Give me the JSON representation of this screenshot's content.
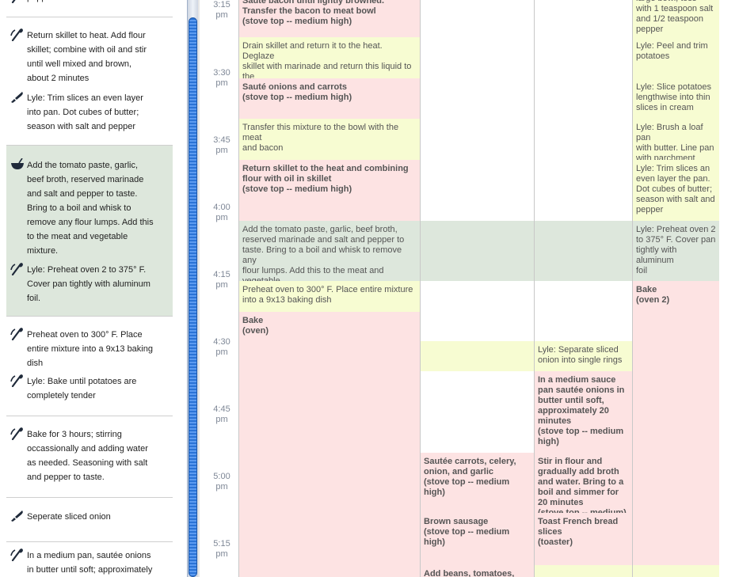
{
  "instructions": [
    {
      "items": [
        {
          "icon": "wooden-spoon-icon",
          "lines": [
            "pepper"
          ]
        }
      ]
    },
    {
      "items": [
        {
          "icon": "wooden-spoon-icon",
          "lines": [
            "Return skillet to heat. Add flour",
            "skillet; combine with oil and stir",
            "until well mixed and brown,",
            "about 2 minutes"
          ]
        },
        {
          "icon": "knife-icon",
          "lines": [
            "Lyle: Trim slices an even layer",
            "into pan. Dot cubes of butter;",
            "season with salt and pepper"
          ]
        }
      ]
    },
    {
      "active": true,
      "items": [
        {
          "icon": "mixing-bowl-icon",
          "lines": [
            "Add the tomato paste, garlic,",
            "beef broth, reserved marinade",
            "and salt and pepper to taste.",
            "Bring to a boil and whisk to",
            "remove any flour lumps. Add this",
            "to the meat and vegetable",
            "mixture."
          ]
        },
        {
          "icon": "wooden-spoon-icon",
          "lines": [
            "Lyle: Preheat oven 2 to 375° F.",
            "Cover pan tightly with aluminum",
            "foil."
          ]
        }
      ]
    },
    {
      "items": [
        {
          "icon": "wooden-spoon-icon",
          "lines": [
            "Preheat oven to 300° F. Place",
            "entire mixture into a 9x13 baking",
            "dish"
          ]
        },
        {
          "icon": "wooden-spoon-icon",
          "lines": [
            "Lyle: Bake until potatoes are",
            "completely tender"
          ]
        }
      ]
    },
    {
      "items": [
        {
          "icon": "wooden-spoon-icon",
          "lines": [
            "Bake for 3 hours; stirring",
            "occassionally and adding water",
            "as needed. Seasoning with salt",
            "and pepper to taste."
          ]
        }
      ]
    },
    {
      "items": [
        {
          "icon": "knife-icon",
          "lines": [
            "Seperate sliced onion"
          ]
        }
      ]
    },
    {
      "items": [
        {
          "icon": "wooden-spoon-icon",
          "lines": [
            "In a medium pan, sautée onions",
            "in butter until soft; approximately"
          ]
        }
      ]
    }
  ],
  "times": [
    [
      "3:15",
      "pm"
    ],
    [
      "3:30",
      "pm"
    ],
    [
      "3:45",
      "pm"
    ],
    [
      "4:00",
      "pm"
    ],
    [
      "4:15",
      "pm"
    ],
    [
      "4:30",
      "pm"
    ],
    [
      "4:45",
      "pm"
    ],
    [
      "5:00",
      "pm"
    ],
    [
      "5:15",
      "pm"
    ]
  ],
  "schedule": {
    "col1": [
      {
        "color": "pink",
        "bold": true,
        "lines": [
          "Sauté bacon until lightly browned.",
          "Transfer the bacon to meat bowl",
          "(stove top -- medium high)"
        ]
      },
      {
        "color": "yellow",
        "bold": false,
        "lines": [
          "Drain skillet and return it to the heat. Deglaze",
          "skillet with marinade and return this liquid to the",
          "reserved marinade"
        ]
      },
      {
        "color": "pink",
        "bold": true,
        "lines": [
          "Sauté onions and carrots",
          "(stove top -- medium high)"
        ]
      },
      {
        "color": "yellow",
        "bold": false,
        "lines": [
          "Transfer this mixture to the bowl with the meat",
          "and bacon"
        ]
      },
      {
        "color": "pink",
        "bold": true,
        "lines": [
          "Return skillet to the heat and combining",
          "flour with oil in skillet",
          "(stove top -- medium high)"
        ]
      },
      {
        "color": "green",
        "bold": false,
        "lines": [
          "Add the tomato paste, garlic, beef broth,",
          "reserved marinade and salt and pepper to",
          "taste. Bring to a boil and whisk to remove any",
          "flour lumps. Add this to the meat and vegetable",
          "mixture."
        ]
      },
      {
        "color": "yellow",
        "bold": false,
        "lines": [
          "Preheat oven to 300° F. Place entire mixture",
          "into a 9x13 baking dish"
        ]
      },
      {
        "color": "pink",
        "bold": true,
        "lines": [
          "Bake",
          "(oven)"
        ]
      }
    ],
    "col2": [
      {
        "color": "green",
        "bold": false,
        "lines": []
      },
      {
        "color": "yellow",
        "bold": false,
        "lines": []
      },
      {
        "color": "pink",
        "bold": true,
        "lines": [
          "Sautée carrots, celery,",
          "onion, and garlic",
          "(stove top -- medium",
          "high)"
        ]
      },
      {
        "color": "pink",
        "bold": true,
        "lines": [
          "Brown sausage",
          "(stove top -- medium",
          "high)"
        ]
      },
      {
        "color": "pink",
        "bold": true,
        "lines": [
          "Add beans, tomatoes,"
        ]
      }
    ],
    "col3": [
      {
        "color": "green",
        "bold": false,
        "lines": []
      },
      {
        "color": "yellow",
        "bold": false,
        "lines": [
          "Lyle: Separate sliced",
          "onion into single rings"
        ]
      },
      {
        "color": "pink",
        "bold": true,
        "lines": [
          "In a medium sauce",
          "pan sautée onions in",
          "butter until soft,",
          "approximately 20",
          "minutes",
          "(stove top -- medium",
          "high)"
        ]
      },
      {
        "color": "pink",
        "bold": true,
        "lines": [
          "Stir in flour and",
          "gradually add broth",
          "and water. Bring to a",
          "boil and simmer for",
          "20 minutes",
          "(stove top -- medium)"
        ]
      },
      {
        "color": "pink",
        "bold": true,
        "lines": [
          "Toast French bread",
          "slices",
          "(toaster)"
        ]
      },
      {
        "color": "yellow",
        "bold": false,
        "lines": []
      }
    ],
    "col4": [
      {
        "color": "yellow",
        "bold": false,
        "lines": [
          "large bowl, toss",
          "with 1 teaspoon salt",
          "and 1/2 teaspoon",
          "pepper"
        ]
      },
      {
        "color": "yellow",
        "bold": false,
        "lines": [
          "Lyle: Peel and trim",
          "potatoes"
        ]
      },
      {
        "color": "yellow",
        "bold": false,
        "lines": [
          "Lyle: Slice potatoes",
          "lengthwise into thin",
          "slices in cream"
        ]
      },
      {
        "color": "yellow",
        "bold": false,
        "lines": [
          "Lyle: Brush a loaf pan",
          "with butter. Line pan",
          "with parchment paper"
        ]
      },
      {
        "color": "yellow",
        "bold": false,
        "lines": [
          "Lyle: Trim slices an",
          "even layer the pan.",
          "Dot cubes of butter;",
          "season with salt and",
          "pepper"
        ]
      },
      {
        "color": "green",
        "bold": false,
        "lines": [
          "Lyle: Preheat oven 2",
          "to 375° F. Cover pan",
          "tightly with aluminum",
          "foil"
        ]
      },
      {
        "color": "pink",
        "bold": true,
        "lines": [
          "Bake",
          "(oven 2)"
        ]
      },
      {
        "color": "yellow",
        "bold": false,
        "lines": []
      }
    ]
  }
}
